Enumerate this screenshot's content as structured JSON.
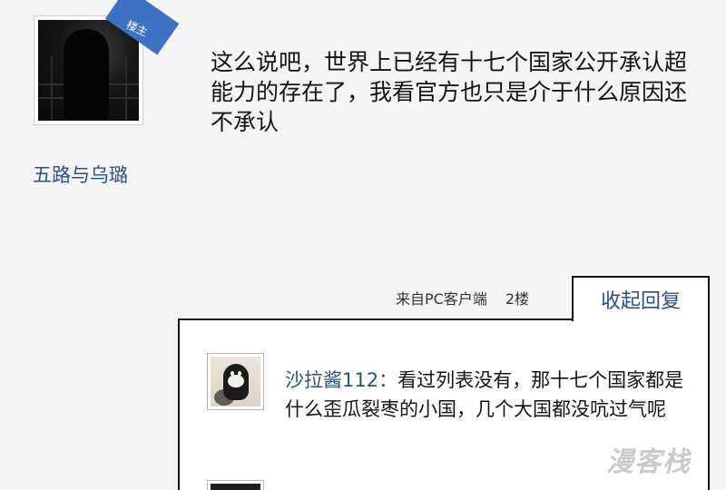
{
  "post": {
    "badge": "楼主",
    "username": "五路与乌璐",
    "content": "这么说吧，世界上已经有十七个国家公开承认超能力的存在了，我看官方也只是介于什么原因还不承认"
  },
  "meta": {
    "source": "来自PC客户端",
    "floor": "2楼",
    "collapse_label": "收起回复"
  },
  "reply": {
    "username": "沙拉酱112：",
    "content": "看过列表没有，那十七个国家都是什么歪瓜裂枣的小国，几个大国都没吭过气呢"
  },
  "watermark": "漫客栈",
  "colors": {
    "background": "#f4f4f6",
    "username": "#2c4f86",
    "badge": "#3d72c3"
  }
}
